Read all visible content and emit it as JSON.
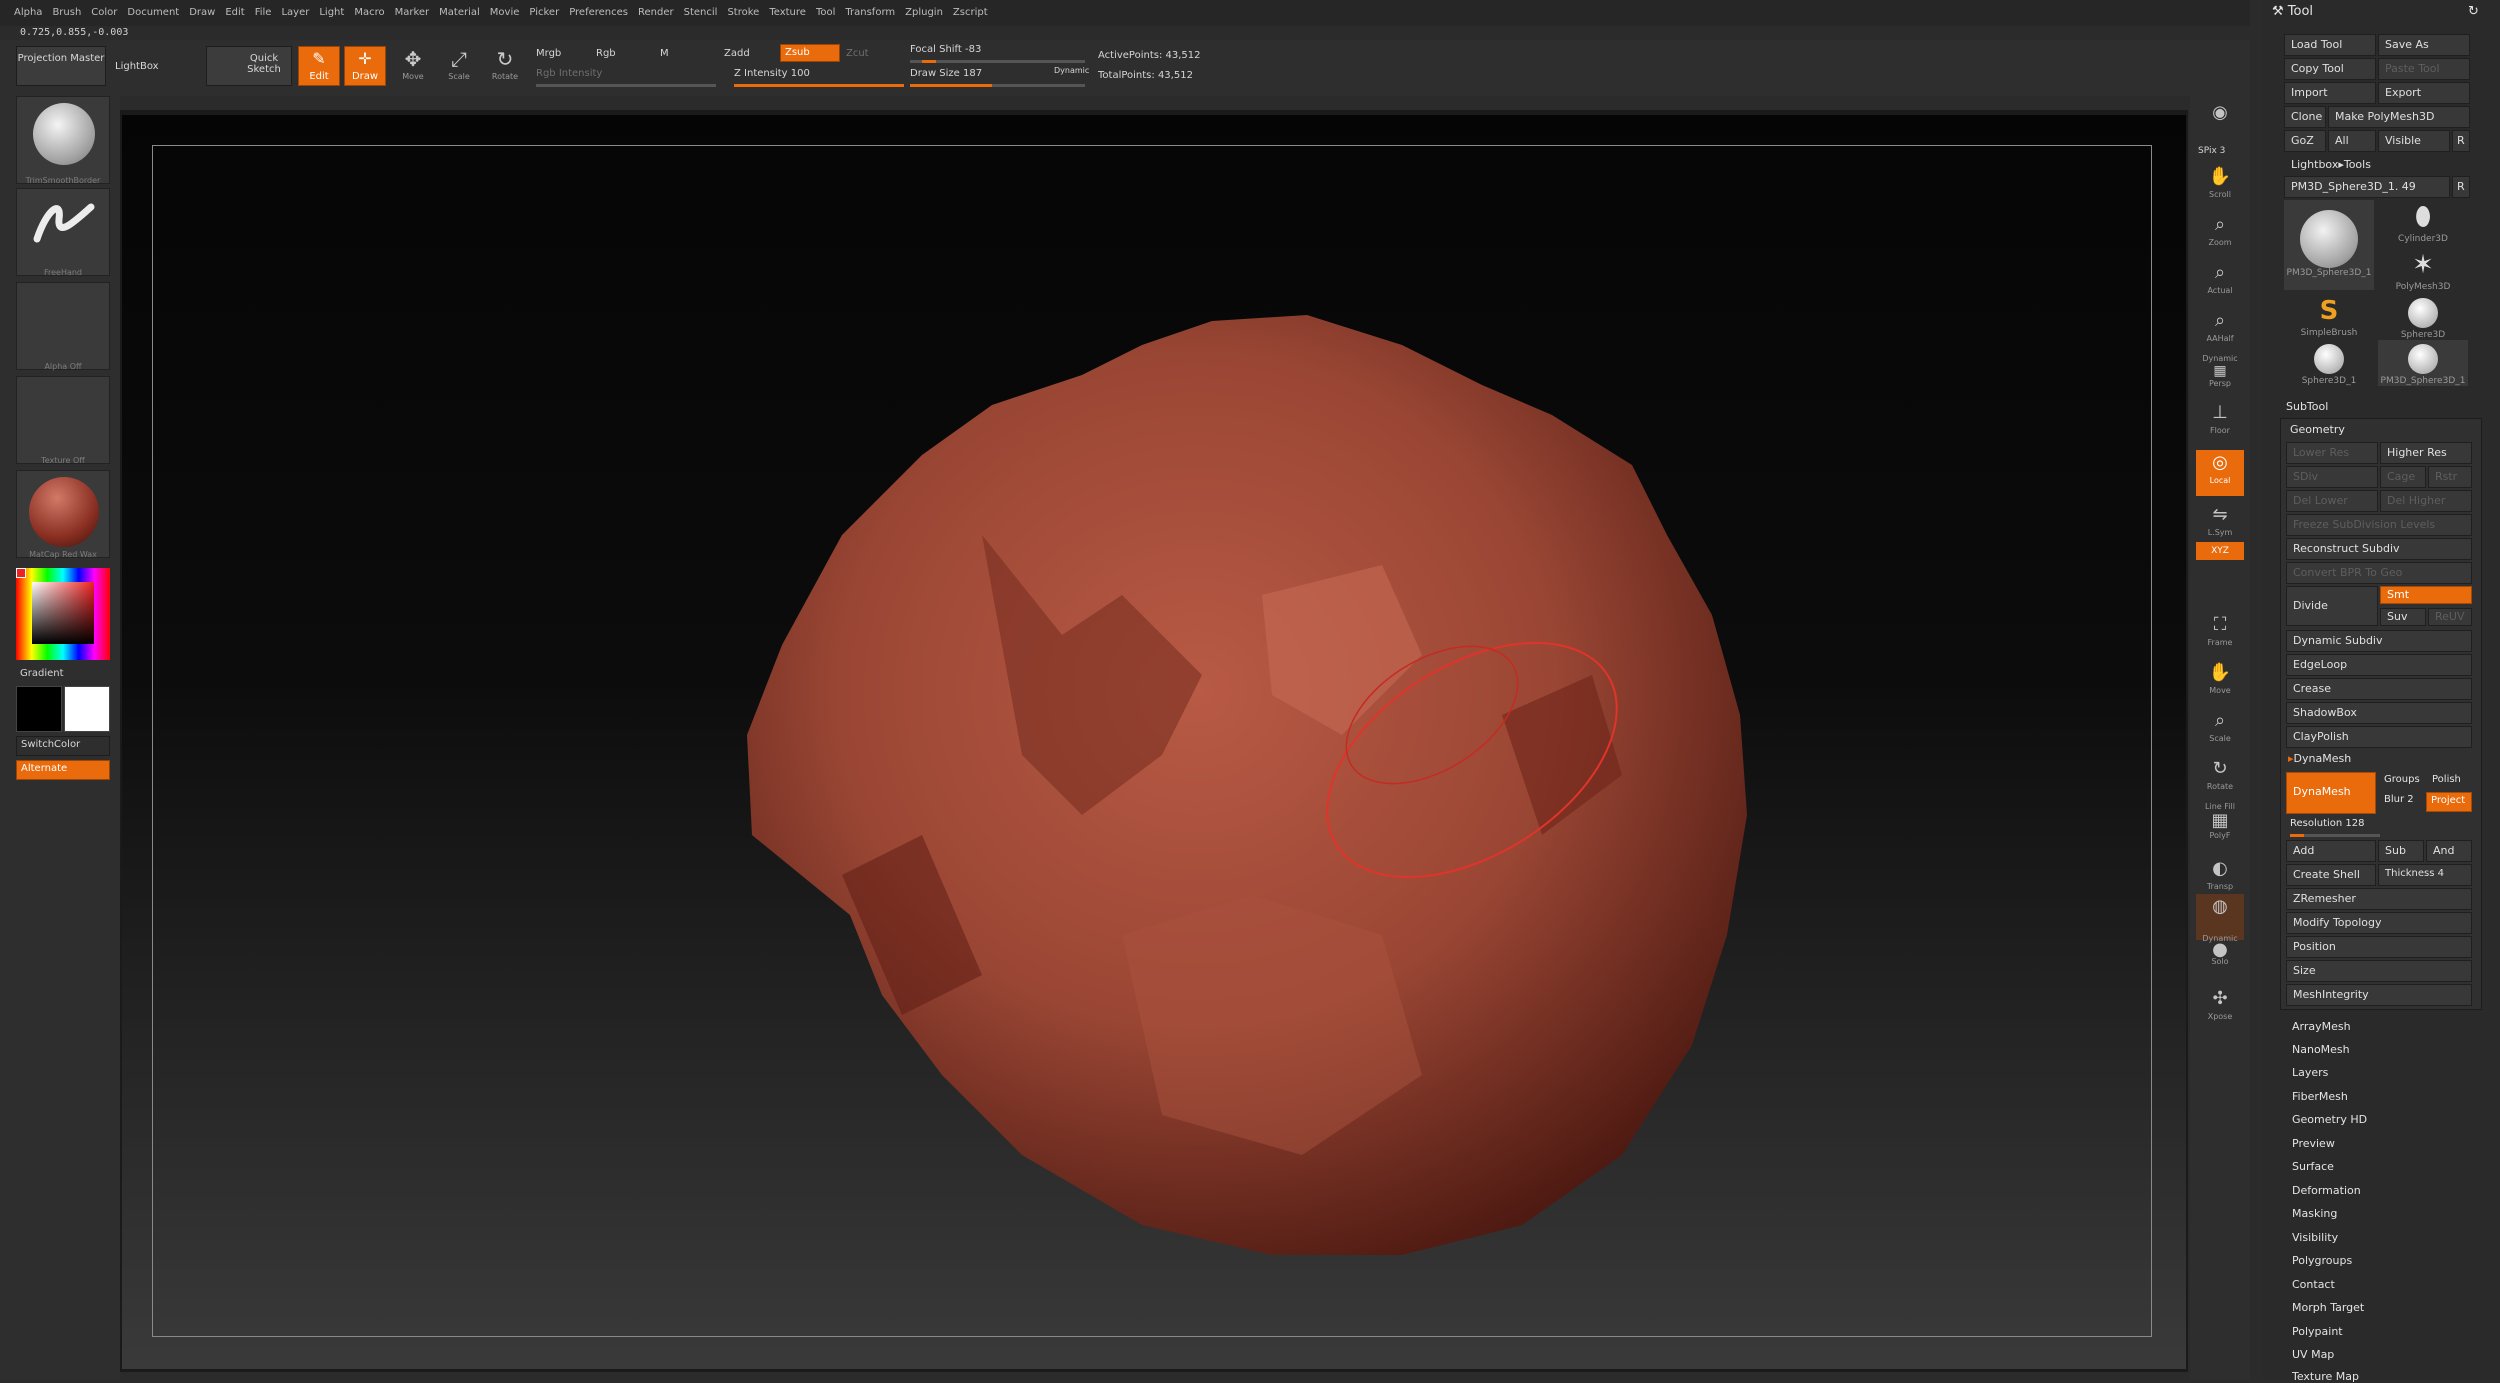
{
  "menu": [
    "Alpha",
    "Brush",
    "Color",
    "Document",
    "Draw",
    "Edit",
    "File",
    "Layer",
    "Light",
    "Macro",
    "Marker",
    "Material",
    "Movie",
    "Picker",
    "Preferences",
    "Render",
    "Stencil",
    "Stroke",
    "Texture",
    "Tool",
    "Transform",
    "Zplugin",
    "Zscript"
  ],
  "coords": "0.725,0.855,-0.003",
  "toolbar": {
    "projection_master": "Projection Master",
    "lightbox": "LightBox",
    "quick_sketch": "Quick Sketch",
    "edit": "Edit",
    "draw": "Draw",
    "move": "Move",
    "scale": "Scale",
    "rotate": "Rotate",
    "mrgb": "Mrgb",
    "rgb": "Rgb",
    "m": "M",
    "rgb_intensity": "Rgb Intensity",
    "zadd": "Zadd",
    "zsub": "Zsub",
    "zcut": "Zcut",
    "z_intensity": "Z Intensity 100",
    "focal_shift": "Focal Shift -83",
    "draw_size": "Draw Size 187",
    "dynamic": "Dynamic",
    "active_points": "ActivePoints: 43,512",
    "total_points": "TotalPoints: 43,512"
  },
  "left_shelf": {
    "brush": "TrimSmoothBorder",
    "stroke": "FreeHand",
    "alpha": "Alpha Off",
    "texture": "Texture Off",
    "material": "MatCap Red Wax",
    "gradient": "Gradient",
    "switch_color": "SwitchColor",
    "alternate": "Alternate"
  },
  "right_shelf": {
    "spix": "SPix 3",
    "scroll": "Scroll",
    "zoom": "Zoom",
    "actual": "Actual",
    "aahalf": "AAHalf",
    "dynamic": "Dynamic",
    "persp": "Persp",
    "floor": "Floor",
    "local": "Local",
    "lsym": "L.Sym",
    "xyz": "XYZ",
    "frame": "Frame",
    "move": "Move",
    "scale": "Scale",
    "rotate": "Rotate",
    "line_fill": "Line Fill",
    "polyf": "PolyF",
    "transp": "Transp",
    "dynamic2": "Dynamic",
    "solo": "Solo",
    "xpose": "Xpose"
  },
  "palette": {
    "title": "Tool",
    "load_tool": "Load Tool",
    "save_as": "Save As",
    "copy_tool": "Copy Tool",
    "paste_tool": "Paste Tool",
    "import": "Import",
    "export": "Export",
    "clone": "Clone",
    "make_polymesh": "Make PolyMesh3D",
    "goz": "GoZ",
    "all": "All",
    "visible": "Visible",
    "r": "R",
    "lightbox_tools": "Lightbox▸Tools",
    "current_tool": "PM3D_Sphere3D_1. 49",
    "tools": [
      {
        "name": "PM3D_Sphere3D_1"
      },
      {
        "name": "Cylinder3D"
      },
      {
        "name": "PolyMesh3D"
      },
      {
        "name": "SimpleBrush"
      },
      {
        "name": "Sphere3D"
      },
      {
        "name": "Sphere3D_1"
      },
      {
        "name": "PM3D_Sphere3D_1"
      }
    ],
    "subtool": "SubTool",
    "geometry": "Geometry",
    "lower_res": "Lower Res",
    "higher_res": "Higher Res",
    "sdiv": "SDiv",
    "cage": "Cage",
    "rstr": "Rstr",
    "del_lower": "Del Lower",
    "del_higher": "Del Higher",
    "freeze_subdiv": "Freeze SubDivision Levels",
    "reconstruct_subdiv": "Reconstruct Subdiv",
    "convert_bpr": "Convert BPR To Geo",
    "divide": "Divide",
    "smt": "Smt",
    "suv": "Suv",
    "reuv": "ReUV",
    "dynamic_subdiv": "Dynamic Subdiv",
    "edgeloop": "EdgeLoop",
    "crease": "Crease",
    "shadowbox": "ShadowBox",
    "claypolish": "ClayPolish",
    "dynamesh_section": "DynaMesh",
    "dynamesh_btn": "DynaMesh",
    "groups": "Groups",
    "polish": "Polish",
    "blur": "Blur 2",
    "project": "Project",
    "resolution": "Resolution 128",
    "add": "Add",
    "sub": "Sub",
    "and": "And",
    "create_shell": "Create Shell",
    "thickness": "Thickness 4",
    "zremesher": "ZRemesher",
    "modify_topology": "Modify Topology",
    "position": "Position",
    "size": "Size",
    "meshintegrity": "MeshIntegrity",
    "sections": [
      "ArrayMesh",
      "NanoMesh",
      "Layers",
      "FiberMesh",
      "Geometry HD",
      "Preview",
      "Surface",
      "Deformation",
      "Masking",
      "Visibility",
      "Polygroups",
      "Contact",
      "Morph Target",
      "Polypaint",
      "UV Map",
      "Texture Map"
    ]
  },
  "colors": {
    "accent": "#e96b0c",
    "mesh": "#9a4634"
  }
}
